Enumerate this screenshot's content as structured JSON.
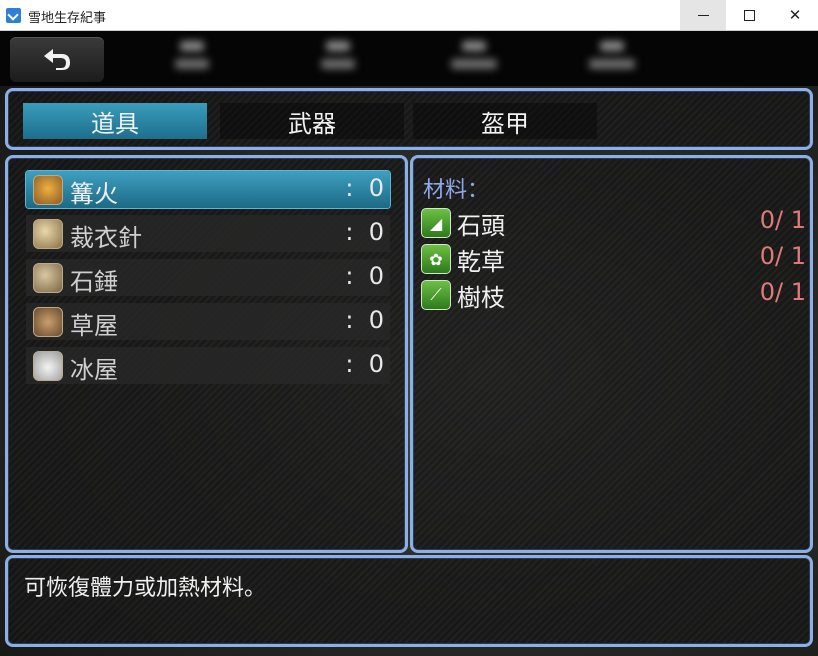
{
  "window": {
    "title": "雪地生存紀事",
    "minimize": "—",
    "maximize": "☐",
    "close": "✕"
  },
  "topbar": {
    "back_icon": "back-arrow-icon",
    "hidden_stats": 4
  },
  "tabs": [
    {
      "label": "道具",
      "active": true
    },
    {
      "label": "武器",
      "active": false
    },
    {
      "label": "盔甲",
      "active": false
    }
  ],
  "items": [
    {
      "name": "篝火",
      "count": ":  0",
      "icon": "campfire-icon",
      "selected": true
    },
    {
      "name": "裁衣針",
      "count": ":  0",
      "icon": "needle-icon",
      "selected": false
    },
    {
      "name": "石錘",
      "count": ":  0",
      "icon": "hammer-icon",
      "selected": false
    },
    {
      "name": "草屋",
      "count": ":  0",
      "icon": "hut-icon",
      "selected": false
    },
    {
      "name": "冰屋",
      "count": ":  0",
      "icon": "igloo-icon",
      "selected": false
    }
  ],
  "materials": {
    "title": "材料：",
    "list": [
      {
        "name": "石頭",
        "count": "0/ 1",
        "icon": "stone-icon"
      },
      {
        "name": "乾草",
        "count": "0/ 1",
        "icon": "hay-icon"
      },
      {
        "name": "樹枝",
        "count": "0/ 1",
        "icon": "branch-icon"
      }
    ]
  },
  "description": "可恢復體力或加熱材料。",
  "colors": {
    "panel_border": "#8cb0e6",
    "selected": "#2f8db0",
    "need_count": "#e07a7a",
    "material_title": "#8ea8e8"
  }
}
